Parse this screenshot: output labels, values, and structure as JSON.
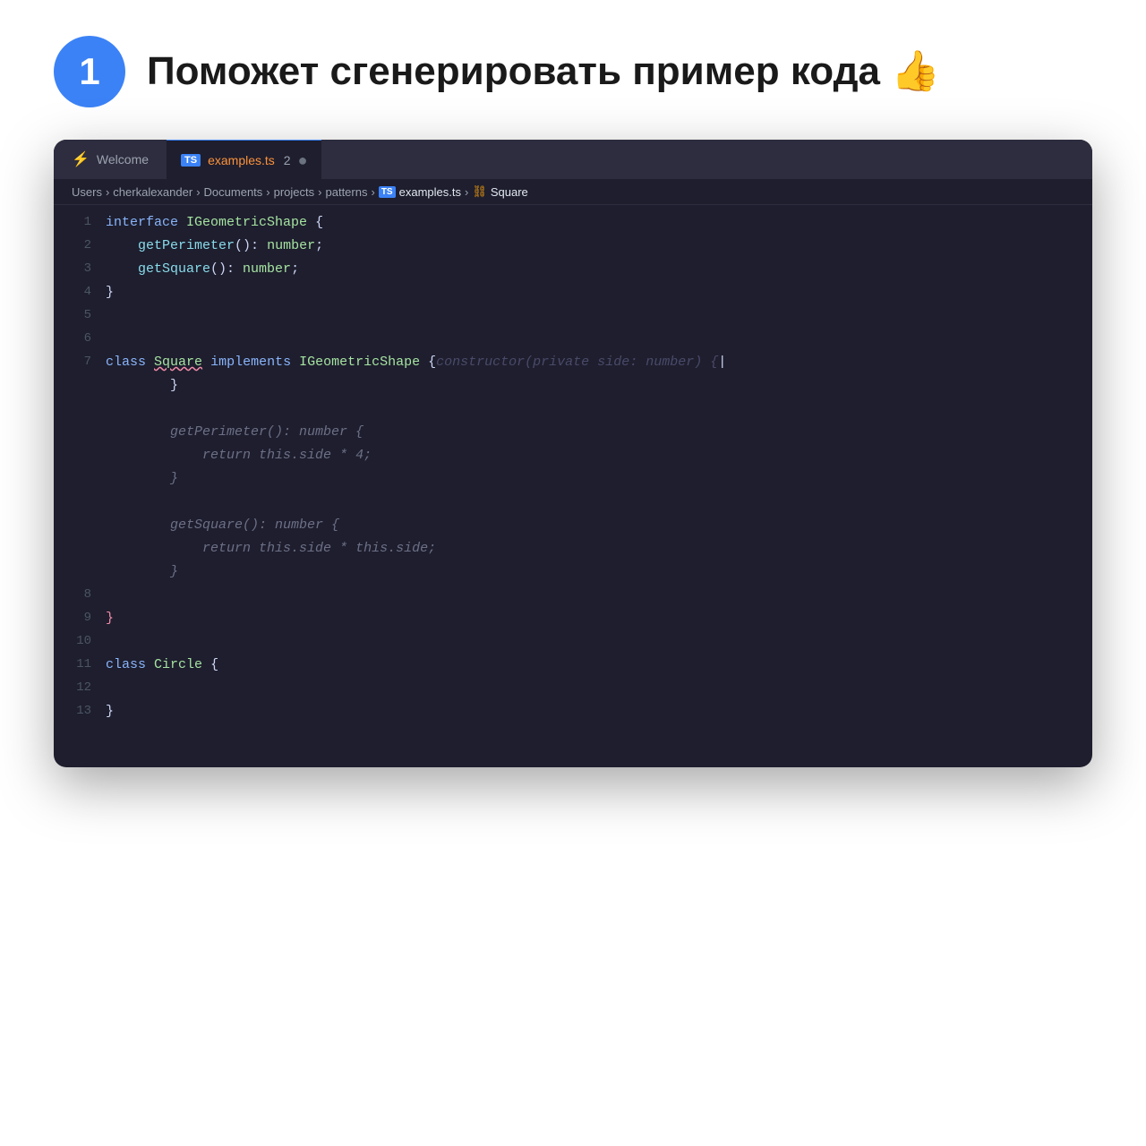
{
  "header": {
    "step_number": "1",
    "title": "Поможет сгенерировать пример кода 👍"
  },
  "tabs": {
    "welcome_label": "Welcome",
    "active_filename": "examples.ts",
    "active_number": "2",
    "active_dot": "●"
  },
  "breadcrumb": {
    "parts": [
      "Users",
      ">",
      "cherkalexander",
      ">",
      "Documents",
      ">",
      "projects",
      ">",
      "patterns",
      ">",
      "examples.ts",
      ">",
      "Square"
    ]
  },
  "code": {
    "lines": [
      {
        "num": "1",
        "content": "interface_IGeometricShape"
      },
      {
        "num": "2",
        "content": "  getPerimeter_number"
      },
      {
        "num": "3",
        "content": "  getSquare_number"
      },
      {
        "num": "4",
        "content": "close_brace"
      },
      {
        "num": "5",
        "content": ""
      },
      {
        "num": "6",
        "content": ""
      },
      {
        "num": "7",
        "content": "class_Square"
      },
      {
        "num": "",
        "content": "constructor_block"
      },
      {
        "num": "",
        "content": "getPerimeter_method"
      },
      {
        "num": "",
        "content": "return_side4"
      },
      {
        "num": "",
        "content": "close_m1"
      },
      {
        "num": "",
        "content": "getSquare_method"
      },
      {
        "num": "",
        "content": "return_side_sq"
      },
      {
        "num": "",
        "content": "close_m2"
      },
      {
        "num": "8",
        "content": ""
      },
      {
        "num": "9",
        "content": "red_close"
      },
      {
        "num": "10",
        "content": ""
      },
      {
        "num": "11",
        "content": "class_Circle"
      },
      {
        "num": "12",
        "content": ""
      },
      {
        "num": "13",
        "content": "close_brace_2"
      }
    ]
  }
}
